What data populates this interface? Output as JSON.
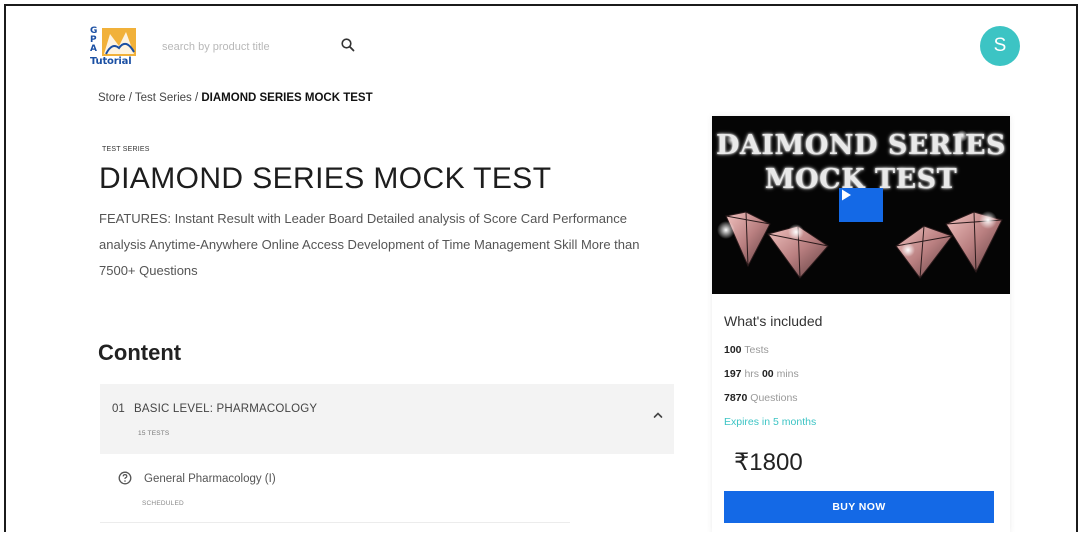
{
  "header": {
    "logo_text": "Tutorial",
    "search_placeholder": "search by product title",
    "avatar_initial": "S"
  },
  "breadcrumb": {
    "store": "Store",
    "separator": " / ",
    "test_series": "Test Series",
    "current": "DIAMOND SERIES MOCK TEST"
  },
  "product": {
    "category": "TEST SERIES",
    "title": "DIAMOND SERIES MOCK TEST",
    "description": "FEATURES: Instant Result with Leader Board Detailed analysis of Score Card Performance analysis Anytime-Anywhere Online Access Development of Time Management Skill More than 7500+ Questions"
  },
  "content": {
    "heading": "Content",
    "sections": [
      {
        "number": "01",
        "title": "BASIC LEVEL: PHARMACOLOGY",
        "count": "15 TESTS",
        "items": [
          {
            "title": "General Pharmacology (I)",
            "status": "SCHEDULED"
          }
        ]
      }
    ]
  },
  "card": {
    "video_title_line1": "DAIMOND SERIES",
    "video_title_line2": "MOCK TEST",
    "included_title": "What's included",
    "tests_count": "100",
    "tests_label": "Tests",
    "duration_hours": "197",
    "hours_label": "hrs",
    "duration_mins": "00",
    "mins_label": "mins",
    "questions_count": "7870",
    "questions_label": "Questions",
    "expires": "Expires in 5 months",
    "price": "₹1800",
    "buy_label": "BUY NOW"
  },
  "colors": {
    "accent_blue": "#1469e6",
    "teal": "#3cc4c4"
  },
  "icons": [
    "search-icon",
    "play-icon",
    "chevron-up-icon",
    "question-circle-icon"
  ]
}
